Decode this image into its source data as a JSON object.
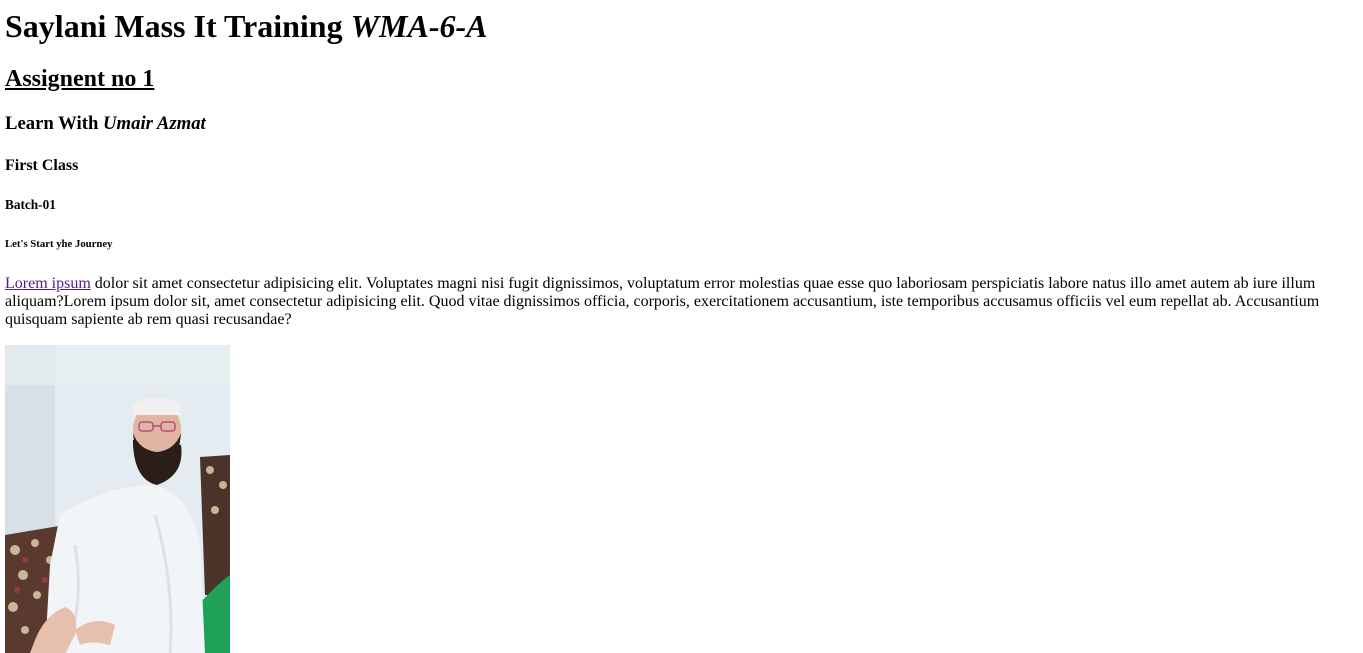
{
  "heading": {
    "title_main": "Saylani Mass It Training ",
    "title_italic": "WMA-6-A",
    "assignment": "Assignent no 1",
    "learn_prefix": "Learn With ",
    "learn_name": "Umair Azmat",
    "class": "First Class",
    "batch": "Batch-01",
    "journey": "Let's Start yhe Journey"
  },
  "paragraph": {
    "link_text": "Lorem ipsum",
    "text": " dolor sit amet consectetur adipisicing elit. Voluptates magni nisi fugit dignissimos, voluptatum error molestias quae esse quo laboriosam perspiciatis labore natus illo amet autem ab iure illum aliquam?Lorem ipsum dolor sit, amet consectetur adipisicing elit. Quod vitae dignissimos officia, corporis, exercitationem accusantium, iste temporibus accusamus officiis vel eum repellat ab. Accusantium quisquam sapiente ab rem quasi recusandae?"
  },
  "colors": {
    "link": "#551a8b",
    "text": "#000000",
    "background": "#ffffff"
  }
}
